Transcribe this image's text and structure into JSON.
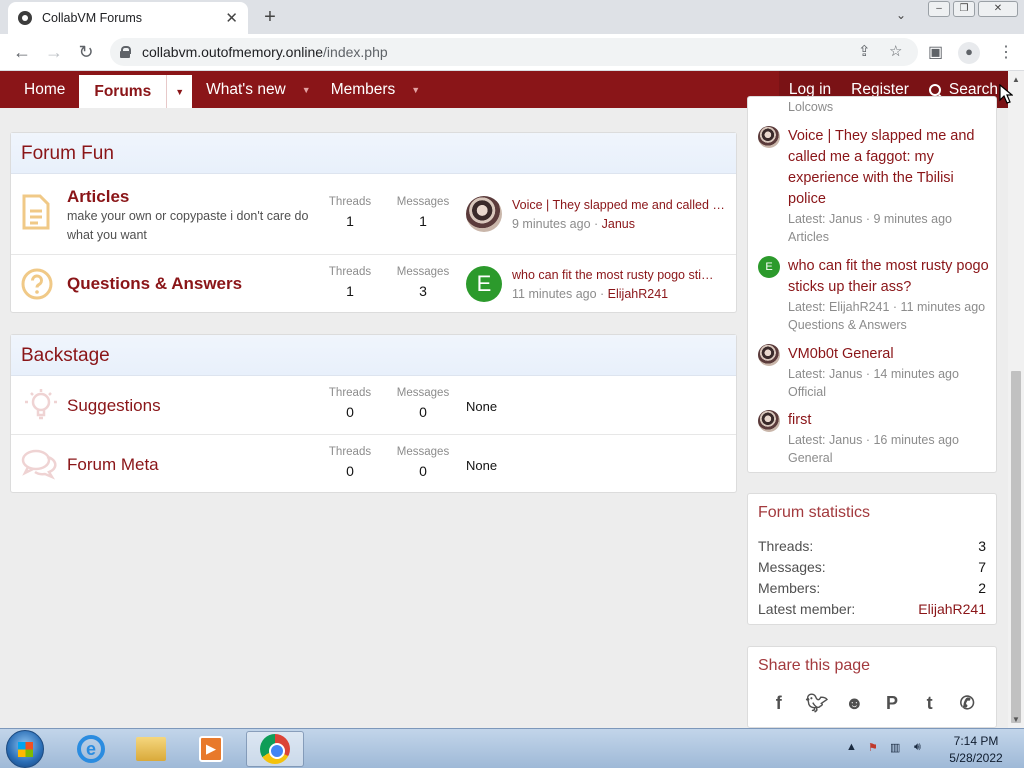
{
  "browser": {
    "tab_title": "CollabVM Forums",
    "url_host": "collabvm.outofmemory.online",
    "url_path": "/index.php"
  },
  "nav": {
    "items": [
      "Home",
      "Forums",
      "What's new",
      "Members"
    ],
    "login": "Log in",
    "register": "Register",
    "search": "Search"
  },
  "categories": [
    {
      "title": "Forum Fun",
      "forums": [
        {
          "title": "Articles",
          "description": "make your own or copypaste i don't care do what you want",
          "threads_label": "Threads",
          "threads": "1",
          "messages_label": "Messages",
          "messages": "1",
          "last_title": "Voice | They slapped me and called …",
          "last_time": "9 minutes ago",
          "last_user": "Janus"
        },
        {
          "title": "Questions & Answers",
          "threads_label": "Threads",
          "threads": "1",
          "messages_label": "Messages",
          "messages": "3",
          "last_title": "who can fit the most rusty pogo sti…",
          "last_time": "11 minutes ago",
          "last_user": "ElijahR241",
          "avatar_letter": "E"
        }
      ]
    },
    {
      "title": "Backstage",
      "forums": [
        {
          "title": "Suggestions",
          "threads_label": "Threads",
          "threads": "0",
          "messages_label": "Messages",
          "messages": "0",
          "last": "None"
        },
        {
          "title": "Forum Meta",
          "threads_label": "Threads",
          "threads": "0",
          "messages_label": "Messages",
          "messages": "0",
          "last": "None"
        }
      ]
    }
  ],
  "sidebar": {
    "cut_off_text": "Lolcows",
    "latest_posts": [
      {
        "title": "Voice | They slapped me and called me a faggot: my experience with the Tbilisi police",
        "meta": "Latest: Janus · 9 minutes ago",
        "forum": "Articles"
      },
      {
        "title": "who can fit the most rusty pogo sticks up their ass?",
        "meta": "Latest: ElijahR241 · 11 minutes ago",
        "forum": "Questions & Answers",
        "avatar_letter": "E"
      },
      {
        "title": "VM0b0t General",
        "meta": "Latest: Janus · 14 minutes ago",
        "forum": "Official"
      },
      {
        "title": "first",
        "meta": "Latest: Janus · 16 minutes ago",
        "forum": "General"
      }
    ],
    "stats": {
      "title": "Forum statistics",
      "rows": [
        {
          "label": "Threads:",
          "value": "3"
        },
        {
          "label": "Messages:",
          "value": "7"
        },
        {
          "label": "Members:",
          "value": "2"
        },
        {
          "label": "Latest member:",
          "value": "ElijahR241"
        }
      ]
    },
    "share": {
      "title": "Share this page",
      "icons": [
        "facebook-icon",
        "twitter-icon",
        "reddit-icon",
        "pinterest-icon",
        "tumblr-icon",
        "whatsapp-icon"
      ]
    }
  },
  "taskbar": {
    "time": "7:14 PM",
    "date": "5/28/2022"
  },
  "colors": {
    "brand": "#8a1518",
    "nav_bg": "#8a1518"
  }
}
